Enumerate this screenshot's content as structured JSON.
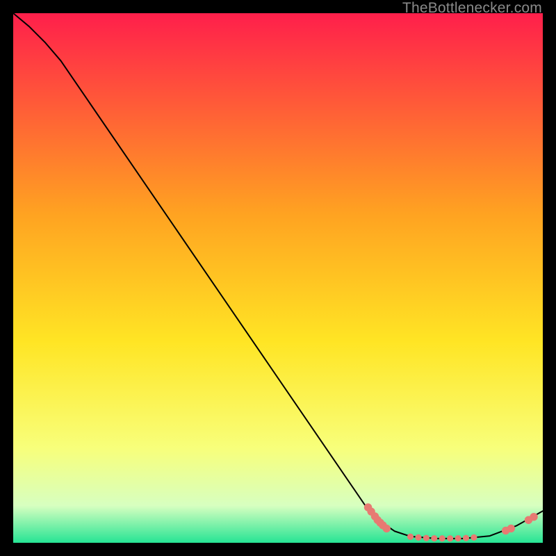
{
  "watermark": "TheBottlenecker.com",
  "chart_data": {
    "type": "line",
    "xlim": [
      0,
      100
    ],
    "ylim": [
      0,
      100
    ],
    "title": "",
    "xlabel": "",
    "ylabel": "",
    "curve": [
      {
        "x": 0.0,
        "y": 100.0
      },
      {
        "x": 3.0,
        "y": 97.5
      },
      {
        "x": 6.0,
        "y": 94.5
      },
      {
        "x": 9.0,
        "y": 91.0
      },
      {
        "x": 66.5,
        "y": 7.0
      },
      {
        "x": 69.0,
        "y": 4.3
      },
      {
        "x": 72.0,
        "y": 2.2
      },
      {
        "x": 75.0,
        "y": 1.2
      },
      {
        "x": 80.0,
        "y": 0.8
      },
      {
        "x": 85.0,
        "y": 0.8
      },
      {
        "x": 90.0,
        "y": 1.3
      },
      {
        "x": 95.0,
        "y": 3.2
      },
      {
        "x": 100.0,
        "y": 6.0
      }
    ],
    "markers": [
      {
        "x": 67.0,
        "y": 6.7,
        "r": 1.0
      },
      {
        "x": 67.6,
        "y": 5.9,
        "r": 1.0
      },
      {
        "x": 68.3,
        "y": 5.0,
        "r": 1.0
      },
      {
        "x": 68.8,
        "y": 4.3,
        "r": 1.0
      },
      {
        "x": 69.3,
        "y": 3.8,
        "r": 1.0
      },
      {
        "x": 69.8,
        "y": 3.3,
        "r": 1.0
      },
      {
        "x": 70.5,
        "y": 2.7,
        "r": 1.0
      },
      {
        "x": 75.0,
        "y": 1.15,
        "r": 0.8
      },
      {
        "x": 76.5,
        "y": 1.0,
        "r": 0.8
      },
      {
        "x": 78.0,
        "y": 0.9,
        "r": 0.8
      },
      {
        "x": 79.5,
        "y": 0.85,
        "r": 0.8
      },
      {
        "x": 81.0,
        "y": 0.82,
        "r": 0.8
      },
      {
        "x": 82.5,
        "y": 0.82,
        "r": 0.8
      },
      {
        "x": 84.0,
        "y": 0.85,
        "r": 0.8
      },
      {
        "x": 85.5,
        "y": 0.9,
        "r": 0.8
      },
      {
        "x": 87.0,
        "y": 1.0,
        "r": 0.8
      },
      {
        "x": 93.0,
        "y": 2.3,
        "r": 1.0
      },
      {
        "x": 94.0,
        "y": 2.7,
        "r": 1.0
      },
      {
        "x": 97.3,
        "y": 4.3,
        "r": 1.0
      },
      {
        "x": 98.3,
        "y": 4.9,
        "r": 1.0
      }
    ],
    "colors": {
      "gradient_top": "#ff1f4b",
      "gradient_mid_upper": "#ffa321",
      "gradient_mid": "#ffe524",
      "gradient_mid_lower": "#f8ff7a",
      "gradient_lower": "#d7ffc0",
      "gradient_bottom": "#26e494",
      "line": "#000000",
      "marker": "#e77a72"
    }
  }
}
